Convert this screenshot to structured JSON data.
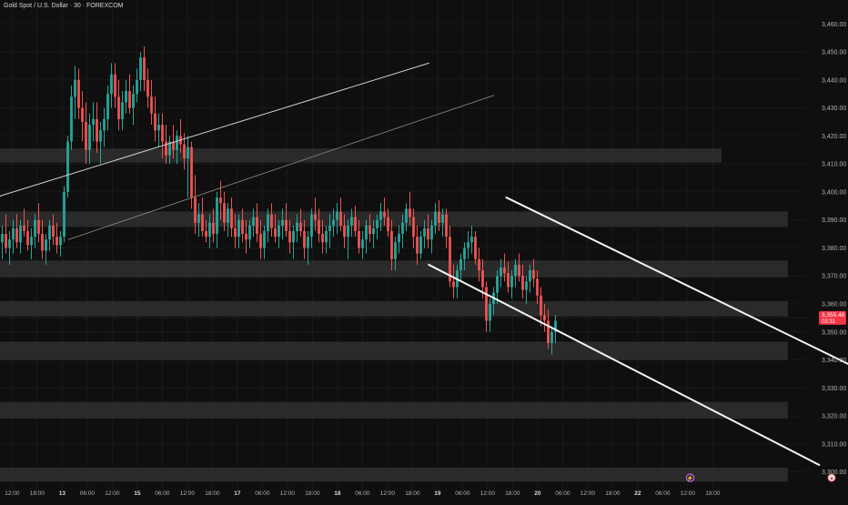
{
  "chart_data": {
    "type": "candlestick",
    "title": "Gold Spot / U.S. Dollar · 30 · FOREXCOM",
    "price_axis": {
      "ylim": [
        3295,
        3464
      ],
      "ticks": [
        "3,460.00",
        "3,450.00",
        "3,440.00",
        "3,430.00",
        "3,420.00",
        "3,410.00",
        "3,400.00",
        "3,390.00",
        "3,380.00",
        "3,370.00",
        "3,360.00",
        "3,350.00",
        "3,340.00",
        "3,330.00",
        "3,320.00",
        "3,310.00",
        "3,300.00"
      ]
    },
    "time_axis": {
      "ticks": [
        {
          "label": "12:00",
          "t": 0.5,
          "bold": false
        },
        {
          "label": "18:00",
          "t": 2.5,
          "bold": false
        },
        {
          "label": "13",
          "t": 4.5,
          "bold": true
        },
        {
          "label": "06:00",
          "t": 6.5,
          "bold": false
        },
        {
          "label": "12:00",
          "t": 8.5,
          "bold": false
        },
        {
          "label": "15",
          "t": 10.5,
          "bold": true
        },
        {
          "label": "06:00",
          "t": 12.5,
          "bold": false
        },
        {
          "label": "12:00",
          "t": 14.5,
          "bold": false
        },
        {
          "label": "18:00",
          "t": 16.5,
          "bold": false
        },
        {
          "label": "17",
          "t": 18.5,
          "bold": true
        },
        {
          "label": "06:00",
          "t": 20.5,
          "bold": false
        },
        {
          "label": "12:00",
          "t": 22.5,
          "bold": false
        },
        {
          "label": "18:00",
          "t": 24.5,
          "bold": false
        },
        {
          "label": "18",
          "t": 26.5,
          "bold": true
        },
        {
          "label": "06:00",
          "t": 28.5,
          "bold": false
        },
        {
          "label": "12:00",
          "t": 30.5,
          "bold": false
        },
        {
          "label": "18:00",
          "t": 32.5,
          "bold": false
        },
        {
          "label": "19",
          "t": 34.5,
          "bold": true
        },
        {
          "label": "06:00",
          "t": 36.5,
          "bold": false
        },
        {
          "label": "12:00",
          "t": 38.5,
          "bold": false
        },
        {
          "label": "18:00",
          "t": 40.5,
          "bold": false
        },
        {
          "label": "20",
          "t": 42.5,
          "bold": true
        },
        {
          "label": "06:00",
          "t": 44.5,
          "bold": false
        },
        {
          "label": "12:00",
          "t": 46.5,
          "bold": false
        },
        {
          "label": "18:00",
          "t": 48.5,
          "bold": false
        },
        {
          "label": "22",
          "t": 50.5,
          "bold": true
        },
        {
          "label": "06:00",
          "t": 52.5,
          "bold": false
        },
        {
          "label": "12:00",
          "t": 54.5,
          "bold": false
        },
        {
          "label": "18:00",
          "t": 56.5,
          "bold": false
        }
      ]
    },
    "last_price": {
      "price": 3355.0,
      "label": "3,355.48",
      "countdown": "03:31"
    },
    "candles": [
      [
        3382,
        3388,
        3376,
        3385
      ],
      [
        3385,
        3392,
        3378,
        3380
      ],
      [
        3380,
        3386,
        3374,
        3383
      ],
      [
        3383,
        3390,
        3378,
        3387
      ],
      [
        3387,
        3392,
        3380,
        3382
      ],
      [
        3382,
        3390,
        3378,
        3388
      ],
      [
        3388,
        3394,
        3384,
        3386
      ],
      [
        3386,
        3390,
        3379,
        3381
      ],
      [
        3381,
        3387,
        3376,
        3384
      ],
      [
        3384,
        3392,
        3380,
        3390
      ],
      [
        3390,
        3396,
        3382,
        3385
      ],
      [
        3385,
        3390,
        3376,
        3379
      ],
      [
        3379,
        3385,
        3374,
        3383
      ],
      [
        3383,
        3390,
        3379,
        3388
      ],
      [
        3388,
        3392,
        3381,
        3384
      ],
      [
        3384,
        3389,
        3378,
        3381
      ],
      [
        3381,
        3386,
        3377,
        3384
      ],
      [
        3384,
        3402,
        3382,
        3400
      ],
      [
        3400,
        3420,
        3398,
        3418
      ],
      [
        3418,
        3438,
        3415,
        3434
      ],
      [
        3434,
        3445,
        3426,
        3440
      ],
      [
        3440,
        3444,
        3426,
        3430
      ],
      [
        3430,
        3436,
        3418,
        3425
      ],
      [
        3425,
        3432,
        3410,
        3415
      ],
      [
        3415,
        3428,
        3410,
        3424
      ],
      [
        3424,
        3432,
        3418,
        3426
      ],
      [
        3426,
        3432,
        3414,
        3418
      ],
      [
        3418,
        3425,
        3410,
        3422
      ],
      [
        3422,
        3430,
        3416,
        3426
      ],
      [
        3426,
        3438,
        3422,
        3435
      ],
      [
        3435,
        3446,
        3430,
        3442
      ],
      [
        3442,
        3446,
        3430,
        3434
      ],
      [
        3434,
        3440,
        3422,
        3426
      ],
      [
        3426,
        3436,
        3422,
        3432
      ],
      [
        3432,
        3440,
        3428,
        3436
      ],
      [
        3436,
        3442,
        3428,
        3430
      ],
      [
        3430,
        3438,
        3424,
        3435
      ],
      [
        3435,
        3444,
        3432,
        3440
      ],
      [
        3440,
        3450,
        3436,
        3448
      ],
      [
        3448,
        3452,
        3436,
        3440
      ],
      [
        3440,
        3444,
        3430,
        3434
      ],
      [
        3434,
        3440,
        3424,
        3428
      ],
      [
        3428,
        3434,
        3418,
        3422
      ],
      [
        3422,
        3428,
        3416,
        3424
      ],
      [
        3424,
        3428,
        3412,
        3418
      ],
      [
        3418,
        3424,
        3410,
        3413
      ],
      [
        3413,
        3420,
        3410,
        3418
      ],
      [
        3418,
        3424,
        3412,
        3415
      ],
      [
        3415,
        3422,
        3410,
        3420
      ],
      [
        3420,
        3426,
        3414,
        3417
      ],
      [
        3417,
        3421,
        3408,
        3412
      ],
      [
        3412,
        3420,
        3398,
        3416
      ],
      [
        3416,
        3418,
        3394,
        3398
      ],
      [
        3398,
        3406,
        3385,
        3389
      ],
      [
        3389,
        3396,
        3384,
        3392
      ],
      [
        3392,
        3398,
        3384,
        3386
      ],
      [
        3386,
        3390,
        3382,
        3384
      ],
      [
        3384,
        3392,
        3380,
        3389
      ],
      [
        3389,
        3394,
        3382,
        3385
      ],
      [
        3385,
        3400,
        3380,
        3398
      ],
      [
        3398,
        3404,
        3390,
        3396
      ],
      [
        3396,
        3400,
        3386,
        3389
      ],
      [
        3389,
        3396,
        3384,
        3394
      ],
      [
        3394,
        3398,
        3384,
        3387
      ],
      [
        3387,
        3392,
        3380,
        3384
      ],
      [
        3384,
        3392,
        3380,
        3390
      ],
      [
        3390,
        3394,
        3382,
        3385
      ],
      [
        3385,
        3390,
        3378,
        3383
      ],
      [
        3383,
        3390,
        3380,
        3388
      ],
      [
        3388,
        3394,
        3384,
        3391
      ],
      [
        3391,
        3396,
        3382,
        3385
      ],
      [
        3385,
        3390,
        3376,
        3380
      ],
      [
        3380,
        3388,
        3376,
        3386
      ],
      [
        3386,
        3394,
        3382,
        3392
      ],
      [
        3392,
        3396,
        3384,
        3387
      ],
      [
        3387,
        3392,
        3382,
        3384
      ],
      [
        3384,
        3390,
        3380,
        3388
      ],
      [
        3388,
        3394,
        3383,
        3390
      ],
      [
        3390,
        3396,
        3384,
        3386
      ],
      [
        3386,
        3390,
        3378,
        3382
      ],
      [
        3382,
        3388,
        3376,
        3386
      ],
      [
        3386,
        3392,
        3382,
        3389
      ],
      [
        3389,
        3394,
        3384,
        3386
      ],
      [
        3386,
        3390,
        3376,
        3380
      ],
      [
        3380,
        3386,
        3374,
        3384
      ],
      [
        3384,
        3394,
        3380,
        3392
      ],
      [
        3392,
        3398,
        3386,
        3390
      ],
      [
        3390,
        3394,
        3382,
        3385
      ],
      [
        3385,
        3390,
        3378,
        3382
      ],
      [
        3382,
        3388,
        3378,
        3386
      ],
      [
        3386,
        3392,
        3380,
        3388
      ],
      [
        3388,
        3394,
        3384,
        3390
      ],
      [
        3390,
        3396,
        3385,
        3393
      ],
      [
        3393,
        3398,
        3386,
        3388
      ],
      [
        3388,
        3392,
        3380,
        3384
      ],
      [
        3384,
        3390,
        3376,
        3388
      ],
      [
        3388,
        3394,
        3384,
        3391
      ],
      [
        3391,
        3395,
        3384,
        3386
      ],
      [
        3386,
        3390,
        3378,
        3380
      ],
      [
        3380,
        3386,
        3376,
        3383
      ],
      [
        3383,
        3390,
        3378,
        3388
      ],
      [
        3388,
        3392,
        3382,
        3385
      ],
      [
        3385,
        3390,
        3380,
        3387
      ],
      [
        3387,
        3392,
        3383,
        3390
      ],
      [
        3390,
        3396,
        3386,
        3393
      ],
      [
        3393,
        3398,
        3388,
        3391
      ],
      [
        3391,
        3394,
        3384,
        3386
      ],
      [
        3386,
        3390,
        3372,
        3376
      ],
      [
        3376,
        3384,
        3372,
        3382
      ],
      [
        3382,
        3388,
        3378,
        3385
      ],
      [
        3385,
        3392,
        3380,
        3389
      ],
      [
        3389,
        3396,
        3386,
        3394
      ],
      [
        3394,
        3400,
        3388,
        3391
      ],
      [
        3391,
        3394,
        3380,
        3384
      ],
      [
        3384,
        3388,
        3374,
        3378
      ],
      [
        3378,
        3386,
        3376,
        3384
      ],
      [
        3384,
        3390,
        3380,
        3387
      ],
      [
        3387,
        3392,
        3380,
        3383
      ],
      [
        3383,
        3390,
        3378,
        3388
      ],
      [
        3388,
        3396,
        3385,
        3393
      ],
      [
        3393,
        3397,
        3386,
        3389
      ],
      [
        3389,
        3394,
        3384,
        3392
      ],
      [
        3392,
        3394,
        3380,
        3384
      ],
      [
        3384,
        3388,
        3366,
        3368
      ],
      [
        3368,
        3374,
        3362,
        3366
      ],
      [
        3366,
        3374,
        3362,
        3372
      ],
      [
        3372,
        3378,
        3368,
        3376
      ],
      [
        3376,
        3382,
        3372,
        3380
      ],
      [
        3380,
        3386,
        3376,
        3382
      ],
      [
        3382,
        3388,
        3378,
        3384
      ],
      [
        3384,
        3386,
        3374,
        3376
      ],
      [
        3376,
        3380,
        3368,
        3372
      ],
      [
        3372,
        3376,
        3362,
        3366
      ],
      [
        3366,
        3368,
        3350,
        3354
      ],
      [
        3354,
        3362,
        3350,
        3360
      ],
      [
        3360,
        3366,
        3356,
        3364
      ],
      [
        3364,
        3372,
        3360,
        3370
      ],
      [
        3370,
        3376,
        3366,
        3373
      ],
      [
        3373,
        3378,
        3368,
        3371
      ],
      [
        3371,
        3375,
        3364,
        3366
      ],
      [
        3366,
        3372,
        3362,
        3370
      ],
      [
        3370,
        3376,
        3366,
        3374
      ],
      [
        3374,
        3378,
        3368,
        3370
      ],
      [
        3370,
        3374,
        3362,
        3365
      ],
      [
        3365,
        3370,
        3360,
        3368
      ],
      [
        3368,
        3374,
        3364,
        3372
      ],
      [
        3372,
        3376,
        3366,
        3369
      ],
      [
        3369,
        3372,
        3360,
        3363
      ],
      [
        3363,
        3366,
        3352,
        3356
      ],
      [
        3356,
        3360,
        3350,
        3354
      ],
      [
        3354,
        3358,
        3344,
        3346
      ],
      [
        3346,
        3352,
        3342,
        3350
      ],
      [
        3350,
        3356,
        3346,
        3354
      ]
    ]
  },
  "overlays": {
    "zones": [
      {
        "name": "zone-3413",
        "top": 3415.5,
        "bottom": 3410.5,
        "end": 57.2
      },
      {
        "name": "zone-3390",
        "top": 3393.0,
        "bottom": 3387.5,
        "end": 62.5
      },
      {
        "name": "zone-3372",
        "top": 3375.5,
        "bottom": 3369.5,
        "end": 62.5
      },
      {
        "name": "zone-3358",
        "top": 3361.0,
        "bottom": 3355.5,
        "end": 62.5
      },
      {
        "name": "zone-3343",
        "top": 3346.5,
        "bottom": 3340.0,
        "end": 62.5
      },
      {
        "name": "zone-3322",
        "top": 3325.0,
        "bottom": 3319.0,
        "end": 62.5
      },
      {
        "name": "zone-3300",
        "top": 3301.5,
        "bottom": 3296.5,
        "end": 62.5
      }
    ],
    "lines": [
      {
        "name": "rising-trendline-upper",
        "t1": -0.5,
        "p1": 3398.5,
        "t2": 33.8,
        "p2": 3446.0,
        "color": "#cfcfcf",
        "width": 1
      },
      {
        "name": "rising-trendline-lower",
        "t1": 5.0,
        "p1": 3383.0,
        "t2": 39.0,
        "p2": 3434.5,
        "color": "#8c8c8c",
        "width": 0.8
      },
      {
        "name": "channel-upper-line",
        "t1": 40.0,
        "p1": 3398.0,
        "t2": 68.5,
        "p2": 3336.0,
        "color": "#f2f2f2",
        "width": 2
      },
      {
        "name": "channel-lower-line",
        "t1": 33.8,
        "p1": 3374.0,
        "t2": 65.0,
        "p2": 3302.5,
        "color": "#f2f2f2",
        "width": 2
      }
    ]
  },
  "markers": [
    {
      "name": "lightning-icon",
      "t": 54.7,
      "glyph": "⚡",
      "fill": "#3a2248",
      "color": "#e18cff"
    },
    {
      "name": "us-flag-icon",
      "t": 66.0,
      "glyph": "●",
      "fill": "#e0e0e0",
      "color": "#d43b3b"
    }
  ],
  "colors": {
    "up": "#26a69a",
    "down": "#ef5350",
    "background": "#0f0f0f",
    "grid": "#1a1a1a",
    "zone": "#2f2f2f",
    "text": "#b2b2b2",
    "price_tag": "#f23645"
  }
}
